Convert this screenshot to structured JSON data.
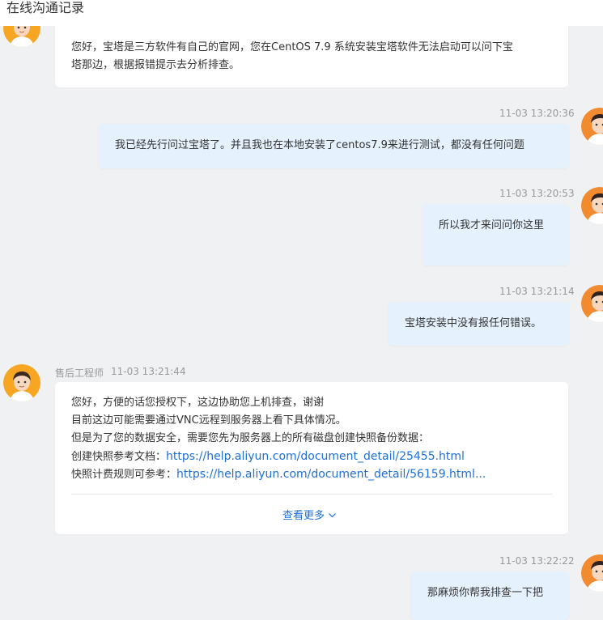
{
  "header": {
    "title": "在线沟通记录"
  },
  "messages": {
    "m1": {
      "line1": "您好，宝塔是三方软件有自己的官网，您在CentOS 7.9 系统安装宝塔软件无法启动可以问下宝",
      "line2": "塔那边，根据报错提示去分析排查。"
    },
    "m2": {
      "time": "11-03 13:20:36",
      "text": "我已经先行问过宝塔了。并且我也在本地安装了centos7.9来进行测试，都没有任何问题"
    },
    "m3": {
      "time": "11-03 13:20:53",
      "text": "所以我才来问问你这里"
    },
    "m4": {
      "time": "11-03 13:21:14",
      "text": "宝塔安装中没有报任何错误。"
    },
    "m5": {
      "sender": "售后工程师",
      "time": "11-03 13:21:44",
      "line1": "您好，方便的话您授权下，这边协助您上机排查，谢谢",
      "line2": "目前这边可能需要通过VNC远程到服务器上看下具体情况。",
      "line3": "但是为了您的数据安全，需要您先为服务器上的所有磁盘创建快照备份数据：",
      "line4_label": "创建快照参考文档：",
      "line4_link": "https://help.aliyun.com/document_detail/25455.html",
      "line5_label": "快照计费规则可参考：",
      "line5_link": "https://help.aliyun.com/document_detail/56159.html...",
      "more": "查看更多"
    },
    "m6": {
      "time": "11-03 13:22:22",
      "text": "那麻烦你帮我排查一下把"
    }
  },
  "colors": {
    "background": "#f0f1f3",
    "user_bubble": "#e5f1fd",
    "agent_bubble": "#ffffff",
    "link": "#1e6fd8"
  },
  "icons": {
    "agent_avatar": "agent-avatar-icon",
    "user_avatar": "user-avatar-icon",
    "chevron": "chevron-down-icon"
  }
}
